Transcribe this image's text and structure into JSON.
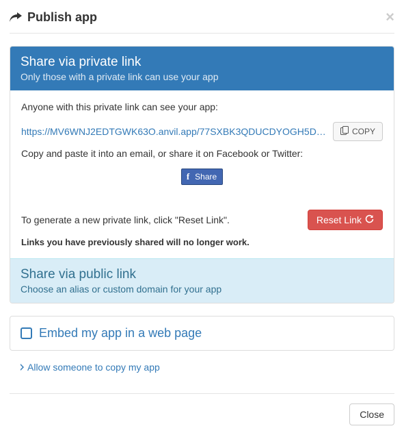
{
  "header": {
    "title": "Publish app",
    "close_symbol": "×"
  },
  "private_link": {
    "title": "Share via private link",
    "subtitle": "Only those with a private link can use your app",
    "intro": "Anyone with this private link can see your app:",
    "url": "https://MV6WNJ2EDTGWK63O.anvil.app/77SXBK3QDUCDYOGH5D…",
    "copy_label": "COPY",
    "hint": "Copy and paste it into an email, or share it on Facebook or Twitter:",
    "fb_share_label": "Share",
    "reset_intro": "To generate a new private link, click \"Reset Link\".",
    "reset_button": "Reset Link",
    "warning": "Links you have previously shared will no longer work."
  },
  "public_link": {
    "title": "Share via public link",
    "subtitle": "Choose an alias or custom domain for your app"
  },
  "embed": {
    "label": "Embed my app in a web page"
  },
  "allow_copy": {
    "label": "Allow someone to copy my app"
  },
  "footer": {
    "close_label": "Close"
  }
}
